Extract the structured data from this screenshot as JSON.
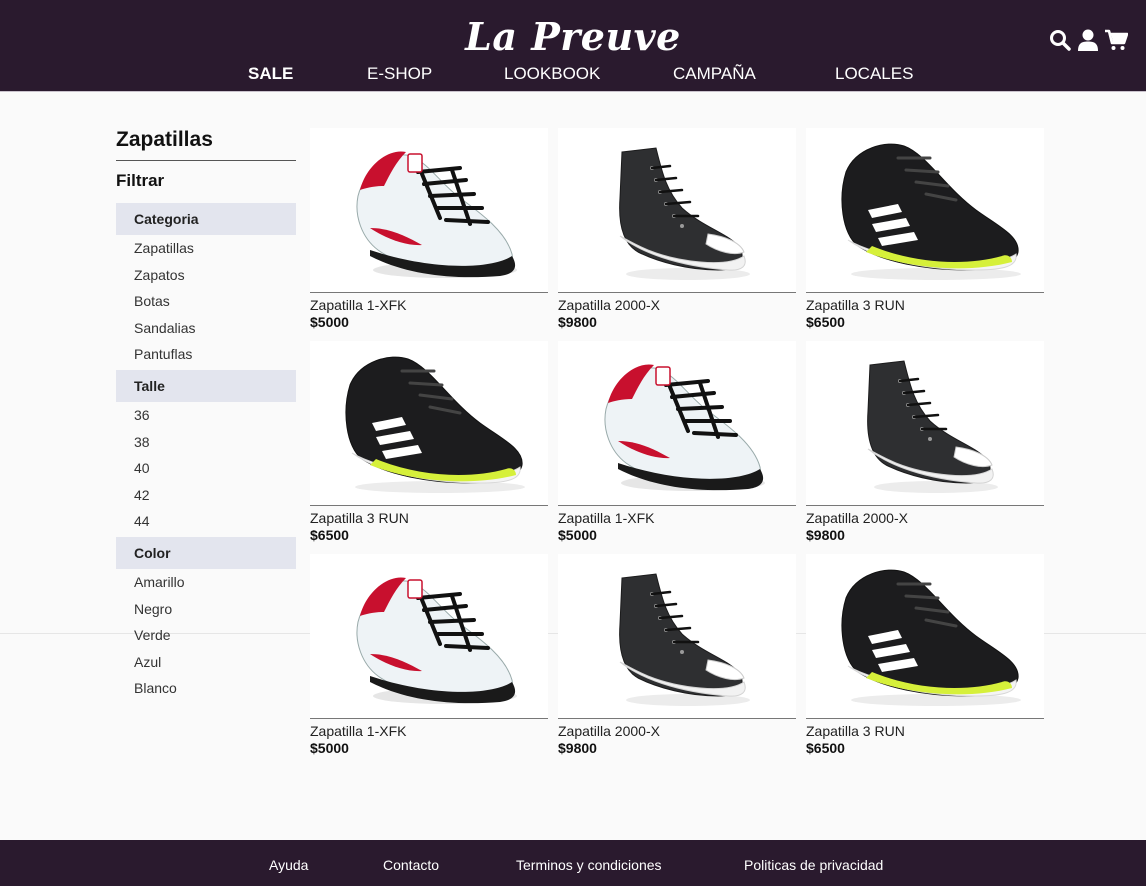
{
  "brand": "La Preuve",
  "nav": [
    "SALE",
    "E-SHOP",
    "LOOKBOOK",
    "CAMPAÑA",
    "LOCALES"
  ],
  "icons": [
    "search-icon",
    "user-icon",
    "cart-icon"
  ],
  "sidebar": {
    "title": "Zapatillas",
    "filter_label": "Filtrar",
    "groups": [
      {
        "title": "Categoria",
        "options": [
          "Zapatillas",
          "Zapatos",
          "Botas",
          "Sandalias",
          "Pantuflas"
        ]
      },
      {
        "title": "Talle",
        "options": [
          "36",
          "38",
          "40",
          "42",
          "44"
        ]
      },
      {
        "title": "Color",
        "options": [
          "Amarillo",
          "Negro",
          "Verde",
          "Azul",
          "Blanco"
        ]
      }
    ]
  },
  "products": [
    {
      "name": "Zapatilla 1-XFK",
      "price": "$5000",
      "image": "white-red-sneaker"
    },
    {
      "name": "Zapatilla 2000-X",
      "price": "$9800",
      "image": "black-hightop-sneaker"
    },
    {
      "name": "Zapatilla 3 RUN",
      "price": "$6500",
      "image": "black-running-sneaker"
    },
    {
      "name": "Zapatilla 3 RUN",
      "price": "$6500",
      "image": "black-running-sneaker"
    },
    {
      "name": "Zapatilla 1-XFK",
      "price": "$5000",
      "image": "white-red-sneaker"
    },
    {
      "name": "Zapatilla 2000-X",
      "price": "$9800",
      "image": "black-hightop-sneaker"
    },
    {
      "name": "Zapatilla 1-XFK",
      "price": "$5000",
      "image": "white-red-sneaker"
    },
    {
      "name": "Zapatilla 2000-X",
      "price": "$9800",
      "image": "black-hightop-sneaker"
    },
    {
      "name": "Zapatilla 3 RUN",
      "price": "$6500",
      "image": "black-running-sneaker"
    }
  ],
  "footer": [
    "Ayuda",
    "Contacto",
    "Terminos y condiciones",
    "Politicas de privacidad"
  ],
  "colors": {
    "header_bg": "#2a1a2e",
    "filter_bg": "#e3e5ee",
    "accent_lime": "#d6f03a",
    "accent_red": "#c8102e"
  }
}
